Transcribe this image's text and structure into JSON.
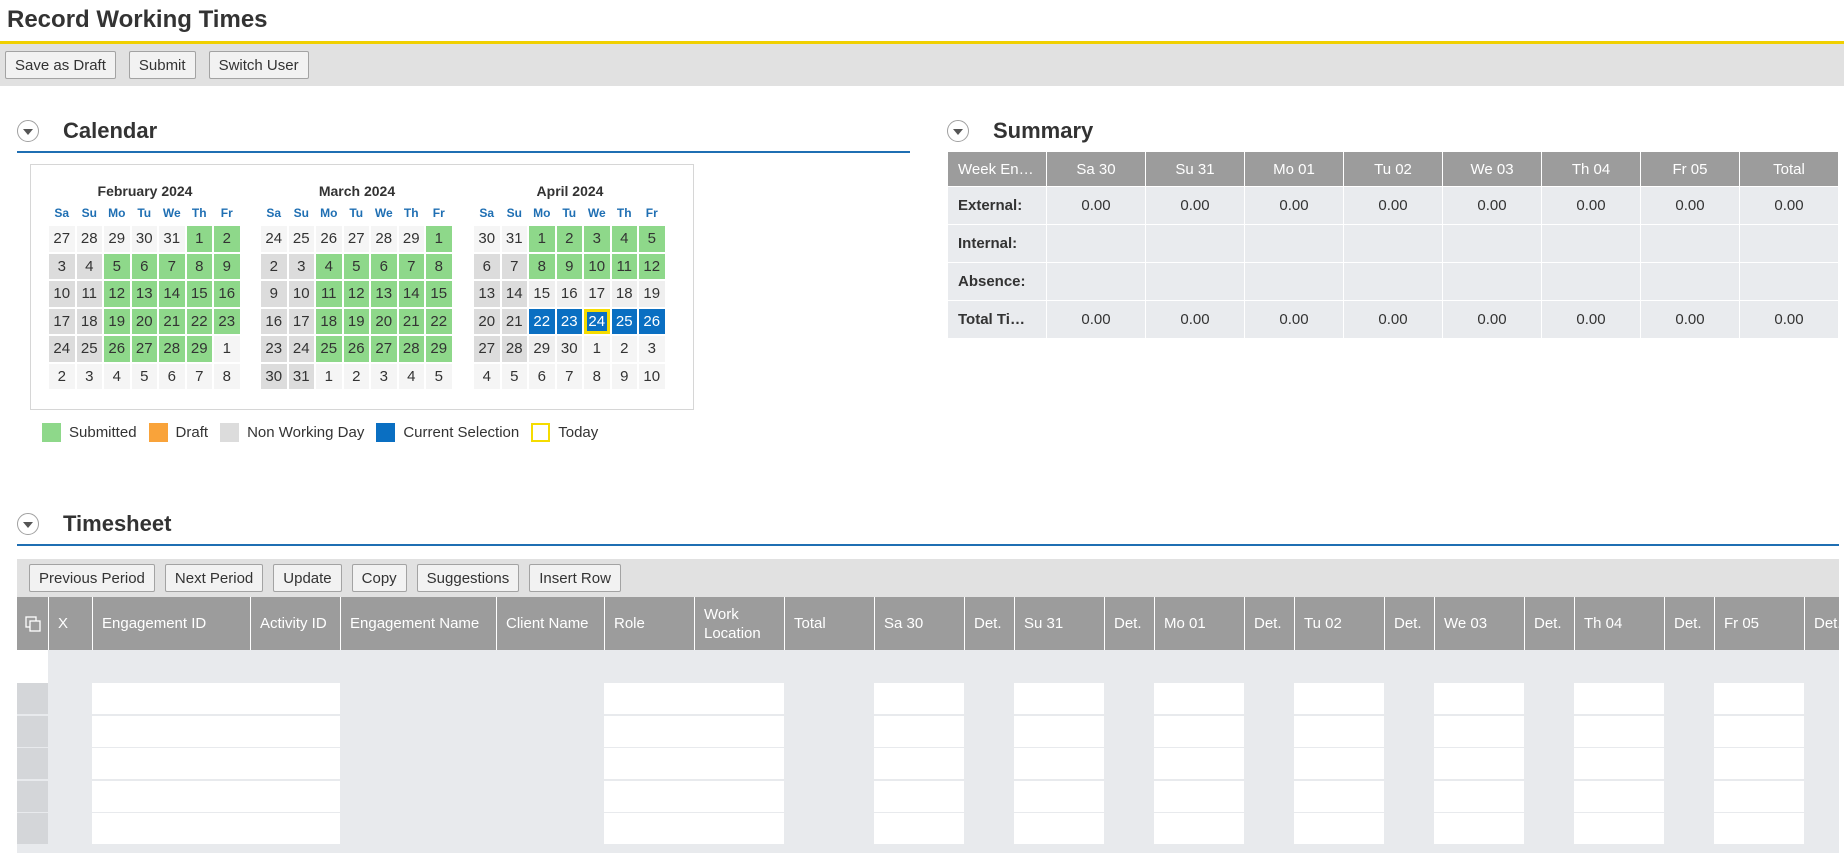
{
  "app": {
    "title": "Record Working Times"
  },
  "toolbar": {
    "save_draft": "Save as Draft",
    "submit": "Submit",
    "switch_user": "Switch User"
  },
  "calendar": {
    "title": "Calendar",
    "weekdays": [
      "Sa",
      "Su",
      "Mo",
      "Tu",
      "We",
      "Th",
      "Fr"
    ],
    "months": [
      {
        "name": "February 2024",
        "days": [
          {
            "d": "27",
            "s": "plain"
          },
          {
            "d": "28",
            "s": "plain"
          },
          {
            "d": "29",
            "s": "plain"
          },
          {
            "d": "30",
            "s": "plain"
          },
          {
            "d": "31",
            "s": "plain"
          },
          {
            "d": "1",
            "s": "sub"
          },
          {
            "d": "2",
            "s": "sub"
          },
          {
            "d": "3",
            "s": "nwd"
          },
          {
            "d": "4",
            "s": "nwd"
          },
          {
            "d": "5",
            "s": "sub"
          },
          {
            "d": "6",
            "s": "sub"
          },
          {
            "d": "7",
            "s": "sub"
          },
          {
            "d": "8",
            "s": "sub"
          },
          {
            "d": "9",
            "s": "sub"
          },
          {
            "d": "10",
            "s": "nwd"
          },
          {
            "d": "11",
            "s": "nwd"
          },
          {
            "d": "12",
            "s": "sub"
          },
          {
            "d": "13",
            "s": "sub"
          },
          {
            "d": "14",
            "s": "sub"
          },
          {
            "d": "15",
            "s": "sub"
          },
          {
            "d": "16",
            "s": "sub"
          },
          {
            "d": "17",
            "s": "nwd"
          },
          {
            "d": "18",
            "s": "nwd"
          },
          {
            "d": "19",
            "s": "sub"
          },
          {
            "d": "20",
            "s": "sub"
          },
          {
            "d": "21",
            "s": "sub"
          },
          {
            "d": "22",
            "s": "sub"
          },
          {
            "d": "23",
            "s": "sub"
          },
          {
            "d": "24",
            "s": "nwd"
          },
          {
            "d": "25",
            "s": "nwd"
          },
          {
            "d": "26",
            "s": "sub"
          },
          {
            "d": "27",
            "s": "sub"
          },
          {
            "d": "28",
            "s": "sub"
          },
          {
            "d": "29",
            "s": "sub"
          },
          {
            "d": "1",
            "s": "plain"
          },
          {
            "d": "2",
            "s": "plain"
          },
          {
            "d": "3",
            "s": "plain"
          },
          {
            "d": "4",
            "s": "plain"
          },
          {
            "d": "5",
            "s": "plain"
          },
          {
            "d": "6",
            "s": "plain"
          },
          {
            "d": "7",
            "s": "plain"
          },
          {
            "d": "8",
            "s": "plain"
          }
        ]
      },
      {
        "name": "March 2024",
        "days": [
          {
            "d": "24",
            "s": "plain"
          },
          {
            "d": "25",
            "s": "plain"
          },
          {
            "d": "26",
            "s": "plain"
          },
          {
            "d": "27",
            "s": "plain"
          },
          {
            "d": "28",
            "s": "plain"
          },
          {
            "d": "29",
            "s": "plain"
          },
          {
            "d": "1",
            "s": "sub"
          },
          {
            "d": "2",
            "s": "nwd"
          },
          {
            "d": "3",
            "s": "nwd"
          },
          {
            "d": "4",
            "s": "sub"
          },
          {
            "d": "5",
            "s": "sub"
          },
          {
            "d": "6",
            "s": "sub"
          },
          {
            "d": "7",
            "s": "sub"
          },
          {
            "d": "8",
            "s": "sub"
          },
          {
            "d": "9",
            "s": "nwd"
          },
          {
            "d": "10",
            "s": "nwd"
          },
          {
            "d": "11",
            "s": "sub"
          },
          {
            "d": "12",
            "s": "sub"
          },
          {
            "d": "13",
            "s": "sub"
          },
          {
            "d": "14",
            "s": "sub"
          },
          {
            "d": "15",
            "s": "sub"
          },
          {
            "d": "16",
            "s": "nwd"
          },
          {
            "d": "17",
            "s": "nwd"
          },
          {
            "d": "18",
            "s": "sub"
          },
          {
            "d": "19",
            "s": "sub"
          },
          {
            "d": "20",
            "s": "sub"
          },
          {
            "d": "21",
            "s": "sub"
          },
          {
            "d": "22",
            "s": "sub"
          },
          {
            "d": "23",
            "s": "nwd"
          },
          {
            "d": "24",
            "s": "nwd"
          },
          {
            "d": "25",
            "s": "sub"
          },
          {
            "d": "26",
            "s": "sub"
          },
          {
            "d": "27",
            "s": "sub"
          },
          {
            "d": "28",
            "s": "sub"
          },
          {
            "d": "29",
            "s": "sub"
          },
          {
            "d": "30",
            "s": "nwd"
          },
          {
            "d": "31",
            "s": "nwd"
          },
          {
            "d": "1",
            "s": "plain"
          },
          {
            "d": "2",
            "s": "plain"
          },
          {
            "d": "3",
            "s": "plain"
          },
          {
            "d": "4",
            "s": "plain"
          },
          {
            "d": "5",
            "s": "plain"
          }
        ]
      },
      {
        "name": "April 2024",
        "days": [
          {
            "d": "30",
            "s": "plain"
          },
          {
            "d": "31",
            "s": "plain"
          },
          {
            "d": "1",
            "s": "sub"
          },
          {
            "d": "2",
            "s": "sub"
          },
          {
            "d": "3",
            "s": "sub"
          },
          {
            "d": "4",
            "s": "sub"
          },
          {
            "d": "5",
            "s": "sub"
          },
          {
            "d": "6",
            "s": "nwd"
          },
          {
            "d": "7",
            "s": "nwd"
          },
          {
            "d": "8",
            "s": "sub"
          },
          {
            "d": "9",
            "s": "sub"
          },
          {
            "d": "10",
            "s": "sub"
          },
          {
            "d": "11",
            "s": "sub"
          },
          {
            "d": "12",
            "s": "sub"
          },
          {
            "d": "13",
            "s": "nwd"
          },
          {
            "d": "14",
            "s": "nwd"
          },
          {
            "d": "15",
            "s": "out"
          },
          {
            "d": "16",
            "s": "out"
          },
          {
            "d": "17",
            "s": "out"
          },
          {
            "d": "18",
            "s": "out"
          },
          {
            "d": "19",
            "s": "out"
          },
          {
            "d": "20",
            "s": "nwd"
          },
          {
            "d": "21",
            "s": "nwd"
          },
          {
            "d": "22",
            "s": "sel"
          },
          {
            "d": "23",
            "s": "sel"
          },
          {
            "d": "24",
            "s": "today"
          },
          {
            "d": "25",
            "s": "sel"
          },
          {
            "d": "26",
            "s": "sel"
          },
          {
            "d": "27",
            "s": "nwd"
          },
          {
            "d": "28",
            "s": "nwd"
          },
          {
            "d": "29",
            "s": "out"
          },
          {
            "d": "30",
            "s": "out"
          },
          {
            "d": "1",
            "s": "plain"
          },
          {
            "d": "2",
            "s": "plain"
          },
          {
            "d": "3",
            "s": "plain"
          },
          {
            "d": "4",
            "s": "plain"
          },
          {
            "d": "5",
            "s": "plain"
          },
          {
            "d": "6",
            "s": "plain"
          },
          {
            "d": "7",
            "s": "plain"
          },
          {
            "d": "8",
            "s": "plain"
          },
          {
            "d": "9",
            "s": "plain"
          },
          {
            "d": "10",
            "s": "plain"
          }
        ]
      }
    ],
    "legend": [
      {
        "label": "Submitted",
        "color": "#8ed88a",
        "border": "#8ed88a"
      },
      {
        "label": "Draft",
        "color": "#f9a33a",
        "border": "#f9a33a"
      },
      {
        "label": "Non Working Day",
        "color": "#dcdcdc",
        "border": "#dcdcdc"
      },
      {
        "label": "Current Selection",
        "color": "#0a6fc2",
        "border": "#0a6fc2"
      },
      {
        "label": "Today",
        "color": "#ffffff",
        "border": "#f5dc00"
      }
    ]
  },
  "summary": {
    "title": "Summary",
    "headers": [
      "Week En…",
      "Sa 30",
      "Su 31",
      "Mo 01",
      "Tu 02",
      "We 03",
      "Th 04",
      "Fr 05",
      "Total"
    ],
    "rows": [
      {
        "label": "External:",
        "values": [
          "0.00",
          "0.00",
          "0.00",
          "0.00",
          "0.00",
          "0.00",
          "0.00",
          "0.00"
        ]
      },
      {
        "label": "Internal:",
        "values": [
          "",
          "",
          "",
          "",
          "",
          "",
          "",
          ""
        ]
      },
      {
        "label": "Absence:",
        "values": [
          "",
          "",
          "",
          "",
          "",
          "",
          "",
          ""
        ]
      },
      {
        "label": "Total Ti…",
        "values": [
          "0.00",
          "0.00",
          "0.00",
          "0.00",
          "0.00",
          "0.00",
          "0.00",
          "0.00"
        ]
      }
    ]
  },
  "timesheet": {
    "title": "Timesheet",
    "buttons": [
      "Previous Period",
      "Next Period",
      "Update",
      "Copy",
      "Suggestions",
      "Insert Row"
    ],
    "columns": [
      "X",
      "Engagement ID",
      "Activity ID",
      "Engagement Name",
      "Client Name",
      "Role",
      "Work Location",
      "Total",
      "Sa 30",
      "Det.",
      "Su 31",
      "Det.",
      "Mo 01",
      "Det.",
      "Tu 02",
      "Det.",
      "We 03",
      "Det.",
      "Th 04",
      "Det.",
      "Fr 05",
      "Det."
    ]
  },
  "colors": {
    "accent": "#1f6fb3",
    "title_underline": "#f0d000",
    "submitted": "#8ed88a",
    "selection": "#0a6fc2",
    "today": "#f5dc00"
  }
}
